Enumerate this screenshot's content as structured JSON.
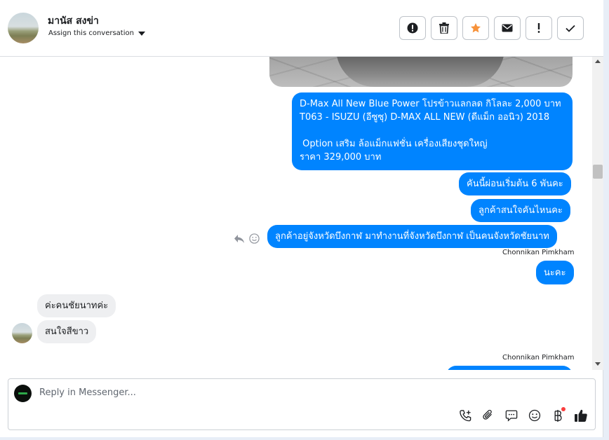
{
  "header": {
    "contact_name": "มานัส สงข่า",
    "assign_label": "Assign this conversation"
  },
  "messages": {
    "outgoing": [
      "D-Max All New Blue Power โปรข้าวแลกลด กิโลละ 2,000 บาท\nT063 - ISUZU (อีซูซุ) D-MAX ALL NEW (ดีแม็ก ออนิว) 2018\n\n Option เสริม ล้อแม็กแฟชั่น เครื่องเสียงชุดใหญ่\nราคา 329,000 บาท",
      "คันนี้ผ่อนเริ่มต้น 6 พันคะ",
      "ลูกค้าสนใจคันไหนคะ",
      "ลูกค้าอยู่จังหวัดบึงกาฬ มาทำงานที่จังหวัดบึงกาฬ เป็นคนจังหวัดชัยนาท",
      "นะคะ"
    ],
    "incoming": [
      "ค่ะคนชัยนาทค่ะ",
      "สนใจสีขาว"
    ],
    "sender_1": "Chonnikan Pimkham",
    "sender_2": "Chonnikan Pimkham"
  },
  "composer": {
    "placeholder": "Reply in Messenger..."
  },
  "colors": {
    "outgoing_bubble": "#0084ff",
    "incoming_bubble": "#eeeff1",
    "star": "#f7923a",
    "notification_dot": "#fa3e3e"
  },
  "icons": {
    "header_actions": [
      "alert-circle-icon",
      "trash-icon",
      "star-icon",
      "envelope-icon",
      "exclamation-icon",
      "check-icon"
    ],
    "composer_tools": [
      "phone-add-icon",
      "paperclip-icon",
      "saved-reply-icon",
      "emoji-icon",
      "payment-icon",
      "thumbs-up-icon"
    ]
  }
}
